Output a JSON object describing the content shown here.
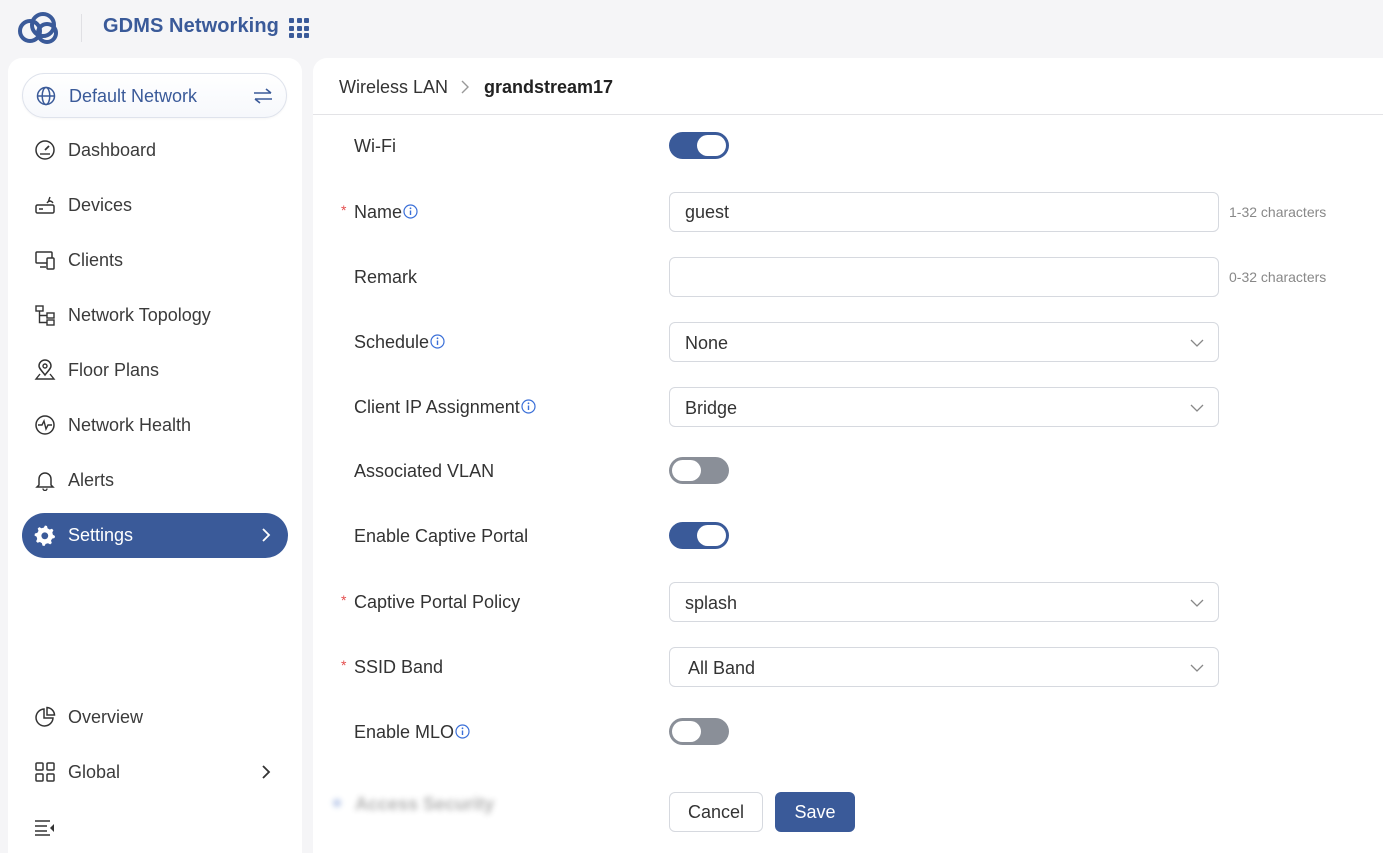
{
  "app": {
    "title": "GDMS Networking",
    "accent_color": "#3a5a99",
    "logo_icon": "cloud-logo-icon",
    "apps_icon": "apps-grid-icon"
  },
  "sidebar": {
    "network_selector": {
      "label": "Default Network",
      "icon": "globe-icon",
      "action_icon": "swap-arrows-icon"
    },
    "items": [
      {
        "label": "Dashboard",
        "icon": "gauge-icon",
        "active": false
      },
      {
        "label": "Devices",
        "icon": "router-icon",
        "active": false
      },
      {
        "label": "Clients",
        "icon": "devices-icon",
        "active": false
      },
      {
        "label": "Network Topology",
        "icon": "topology-icon",
        "active": false
      },
      {
        "label": "Floor Plans",
        "icon": "map-pin-icon",
        "active": false
      },
      {
        "label": "Network Health",
        "icon": "pulse-icon",
        "active": false
      },
      {
        "label": "Alerts",
        "icon": "bell-icon",
        "active": false
      },
      {
        "label": "Settings",
        "icon": "gear-icon",
        "active": true
      }
    ],
    "bottom_items": [
      {
        "label": "Overview",
        "icon": "pie-chart-icon"
      },
      {
        "label": "Global",
        "icon": "grid-icon"
      }
    ],
    "collapse_icon": "collapse-menu-icon"
  },
  "breadcrumb": {
    "parent": "Wireless LAN",
    "current": "grandstream17"
  },
  "form": {
    "wifi": {
      "label": "Wi-Fi",
      "enabled": true
    },
    "name": {
      "label": "Name",
      "required": true,
      "value": "guest",
      "placeholder": "",
      "hint": "1-32 characters"
    },
    "remark": {
      "label": "Remark",
      "value": "",
      "placeholder": "",
      "hint": "0-32 characters"
    },
    "schedule": {
      "label": "Schedule",
      "value": "None"
    },
    "client_ip": {
      "label": "Client IP Assignment",
      "value": "Bridge"
    },
    "vlan": {
      "label": "Associated VLAN",
      "enabled": false
    },
    "captive_portal": {
      "label": "Enable Captive Portal",
      "enabled": true
    },
    "captive_policy": {
      "label": "Captive Portal Policy",
      "required": true,
      "value": "splash"
    },
    "ssid_band": {
      "label": "SSID Band",
      "required": true,
      "value": "All Band"
    },
    "mlo": {
      "label": "Enable MLO",
      "enabled": false
    },
    "required_mark": "*",
    "blurred_section": "Access Security"
  },
  "buttons": {
    "cancel": "Cancel",
    "save": "Save"
  }
}
